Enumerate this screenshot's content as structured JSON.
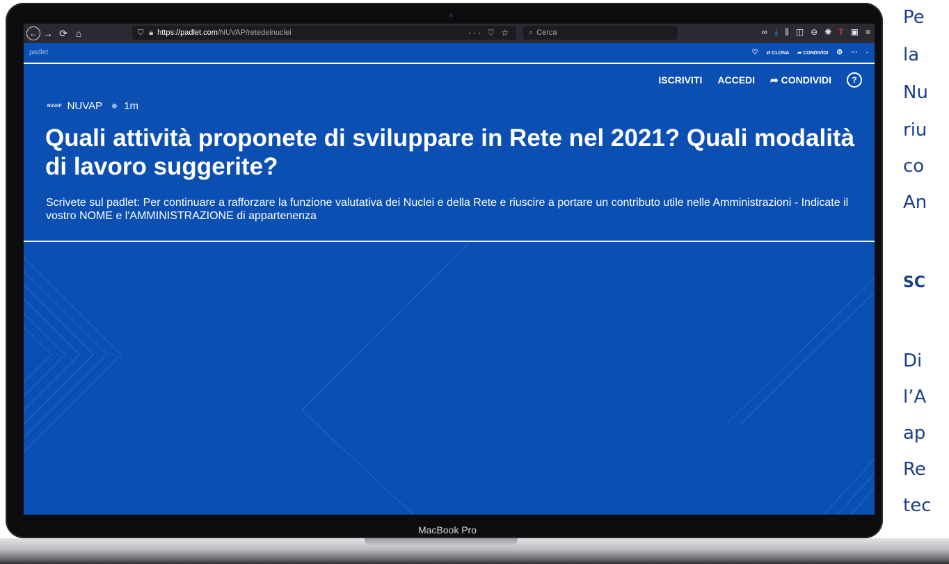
{
  "device": {
    "model": "MacBook Pro"
  },
  "browser": {
    "url_host": "https://padlet.com",
    "url_path": "/NUVAP/retedeinuclei",
    "page_actions": "··· ♡ ☆",
    "search_placeholder": "Cerca"
  },
  "padlet_bar": {
    "logo": "padlet",
    "clone_label": "CLONA",
    "share_label": "CONDIVIDI"
  },
  "header": {
    "signup_label": "ISCRIVITI",
    "login_label": "ACCEDI",
    "share_label": "CONDIVIDI",
    "author_badge": "NUVAP",
    "author": "NUVAP",
    "time_ago": "1m"
  },
  "padlet": {
    "title": "Quali attività proponete di sviluppare in Rete nel 2021? Quali modalità di lavoro suggerite?",
    "description": "Scrivete sul padlet: Per continuare a rafforzare la funzione valutativa dei Nuclei e della Rete e riuscire a portare un contributo utile nelle Amministrazioni - Indicate il vostro NOME e l'AMMINISTRAZIONE di appartenenza"
  },
  "slide_text": {
    "line1": "Pe",
    "line2": "la",
    "line3": "Nu",
    "line4": "riu",
    "line5": "co",
    "line6": "An",
    "line7": "SC",
    "line8": "Di",
    "line9": "l’A",
    "line10": "ap",
    "line11": "Re",
    "line12": "tec"
  },
  "colors": {
    "padlet_blue": "#0b4fb3",
    "toolbar": "#2b2a33",
    "slide_text": "#1a3f8c"
  }
}
